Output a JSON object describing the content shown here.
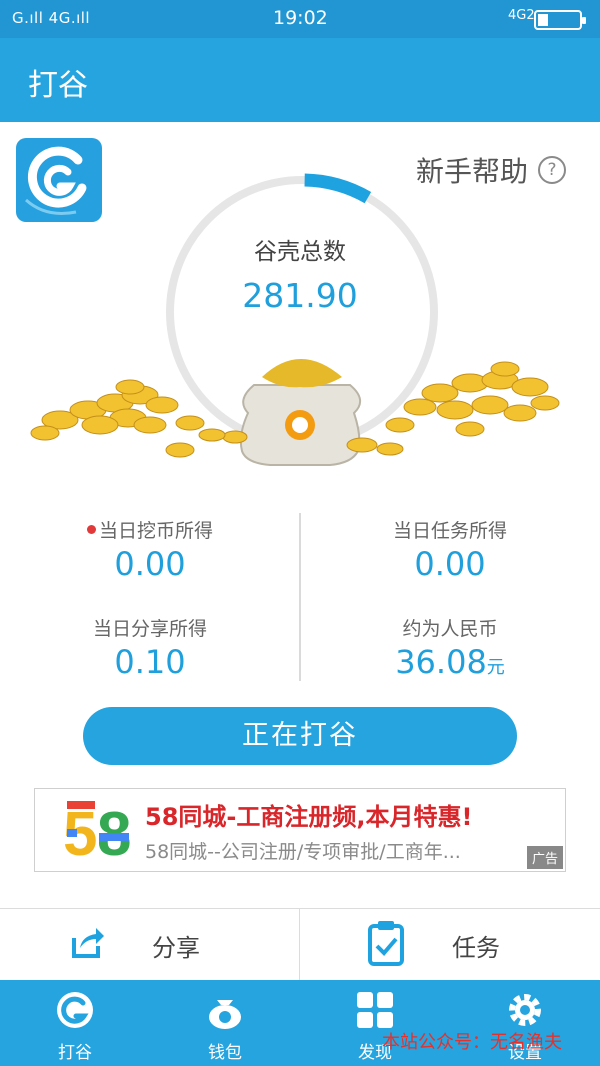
{
  "status_bar": {
    "signal_text": "G.ıll 4G.ıll",
    "time": "19:02",
    "network": "4G2"
  },
  "header": {
    "title": "打谷"
  },
  "help": {
    "label": "新手帮助",
    "icon": "question-circle-icon"
  },
  "total": {
    "label": "谷壳总数",
    "value": "281.90",
    "progress": 0.08
  },
  "stats": [
    {
      "label": "当日挖币所得",
      "value": "0.00"
    },
    {
      "label": "当日任务所得",
      "value": "0.00"
    },
    {
      "label": "当日分享所得",
      "value": "0.10"
    },
    {
      "label": "约为人民币",
      "value": "36.08",
      "unit": "元"
    }
  ],
  "main_button": {
    "label": "正在打谷"
  },
  "ad": {
    "logo_text": "58",
    "title": "58同城-工商注册频,本月特惠!",
    "description": "58同城--公司注册/专项审批/工商年...",
    "tag": "广告"
  },
  "actions": [
    {
      "label": "分享",
      "icon": "share-icon"
    },
    {
      "label": "任务",
      "icon": "clipboard-check-icon"
    }
  ],
  "bottom_nav": [
    {
      "label": "打谷",
      "icon": "app-logo-icon"
    },
    {
      "label": "钱包",
      "icon": "wallet-bag-icon"
    },
    {
      "label": "发现",
      "icon": "grid-icon"
    },
    {
      "label": "设置",
      "icon": "gear-icon"
    }
  ],
  "watermark": "本站公众号：无名渔夫",
  "colors": {
    "primary": "#26a4df",
    "value_blue": "#1f9fdc",
    "ad_red": "#d8262a"
  }
}
